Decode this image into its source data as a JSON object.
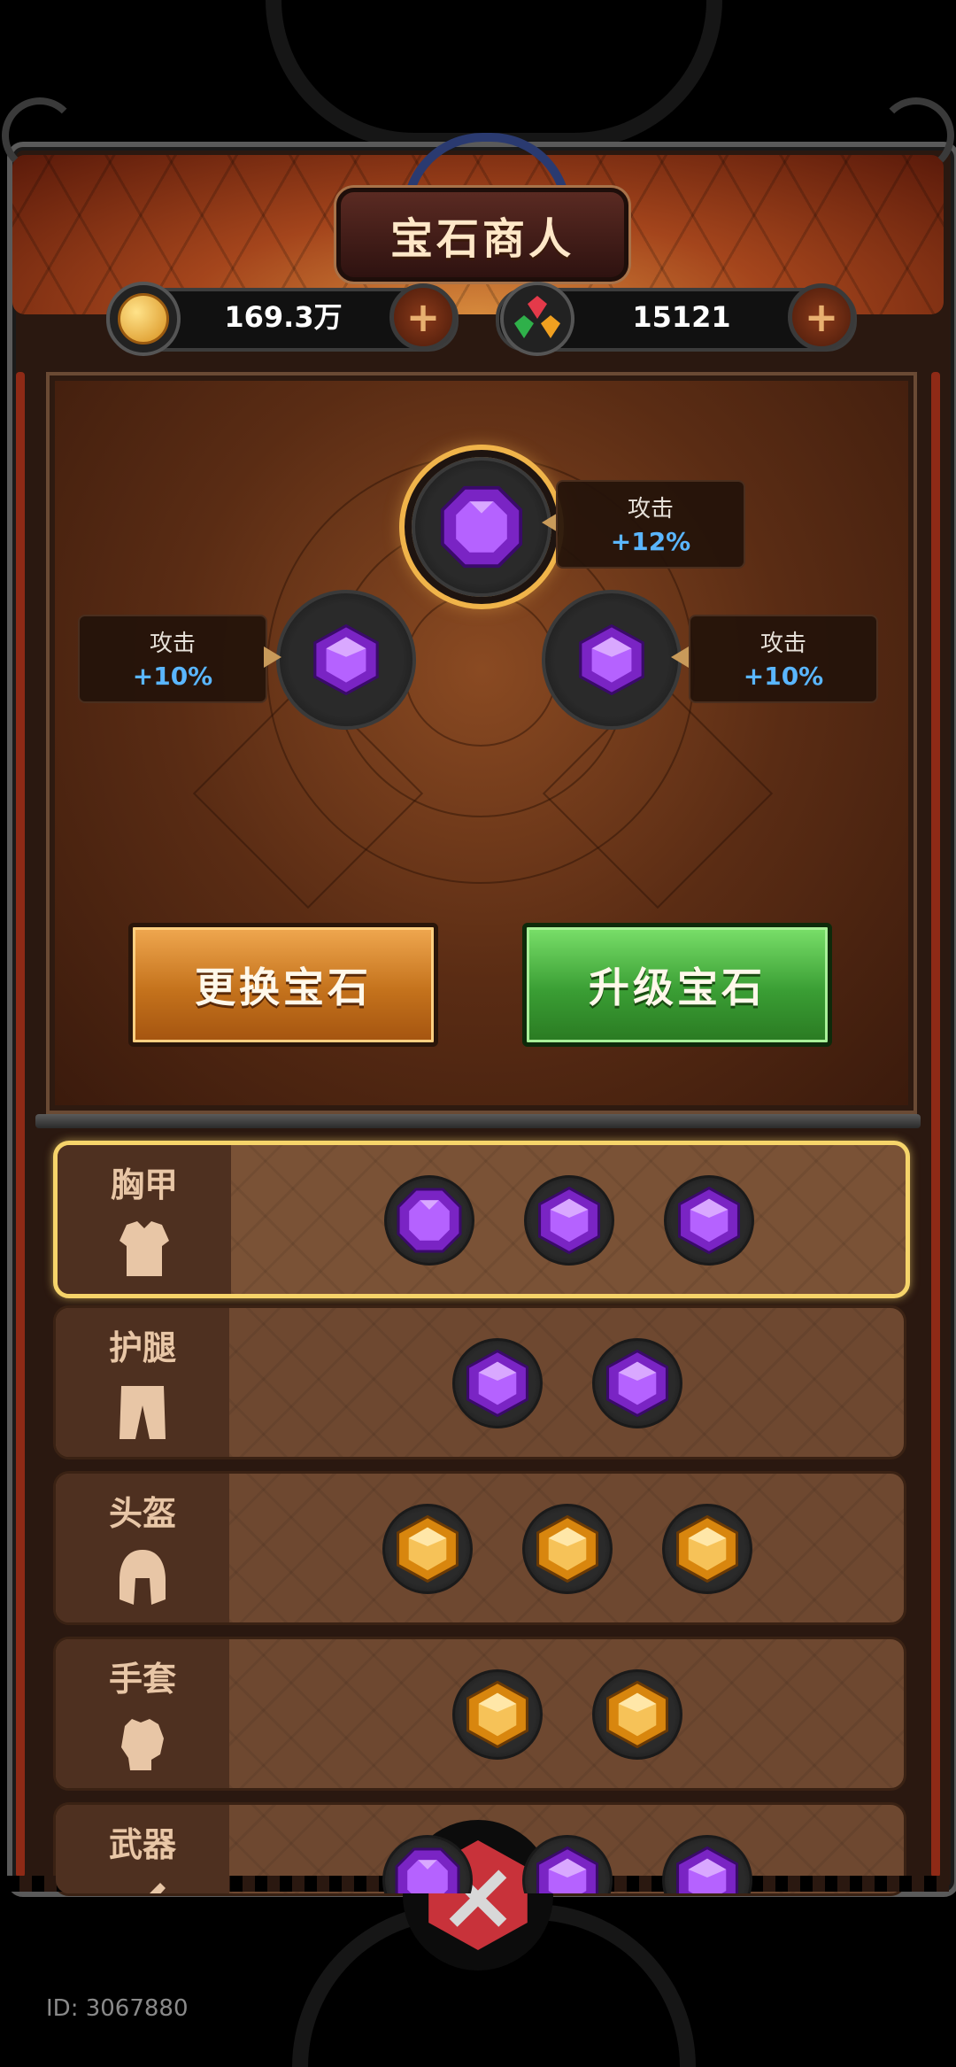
{
  "title": "宝石商人",
  "currency": {
    "coins": "169.3万",
    "gems": "15121",
    "coin_icon": "gold-coin-icon",
    "gem_icon": "gem-cluster-icon",
    "add_icon": "plus-icon"
  },
  "sockets": [
    {
      "position": "top",
      "stat_label": "攻击",
      "stat_value": "+12%",
      "gem_color": "purple",
      "shape": "octagon",
      "selected": true
    },
    {
      "position": "left",
      "stat_label": "攻击",
      "stat_value": "+10%",
      "gem_color": "purple",
      "shape": "hexagon",
      "selected": false
    },
    {
      "position": "right",
      "stat_label": "攻击",
      "stat_value": "+10%",
      "gem_color": "purple",
      "shape": "hexagon",
      "selected": false
    }
  ],
  "buttons": {
    "swap": "更换宝石",
    "upgrade": "升级宝石"
  },
  "equipment": [
    {
      "label": "胸甲",
      "icon": "chest-armor-icon",
      "selected": true,
      "gems": [
        "purple-octagon",
        "purple-hexagon",
        "purple-hexagon"
      ]
    },
    {
      "label": "护腿",
      "icon": "leg-armor-icon",
      "selected": false,
      "gems": [
        "purple-hexagon",
        "purple-hexagon"
      ]
    },
    {
      "label": "头盔",
      "icon": "helmet-icon",
      "selected": false,
      "gems": [
        "gold-hexagon",
        "gold-hexagon",
        "gold-hexagon"
      ]
    },
    {
      "label": "手套",
      "icon": "gauntlet-icon",
      "selected": false,
      "gems": [
        "gold-hexagon",
        "gold-hexagon"
      ]
    },
    {
      "label": "武器",
      "icon": "weapon-icon",
      "selected": false,
      "gems": [
        "purple-octagon",
        "purple-hexagon",
        "purple-hexagon"
      ]
    }
  ],
  "colors": {
    "gem_purple": "#a24ae6",
    "gem_gold": "#f4b23a",
    "stat_value": "#5ab6ff",
    "selected_border": "#f6d46a",
    "swap_button": "#d4861e",
    "upgrade_button": "#3a9e34"
  },
  "close_icon": "crossed-swords-close-icon",
  "footer_id": "ID: 3067880"
}
